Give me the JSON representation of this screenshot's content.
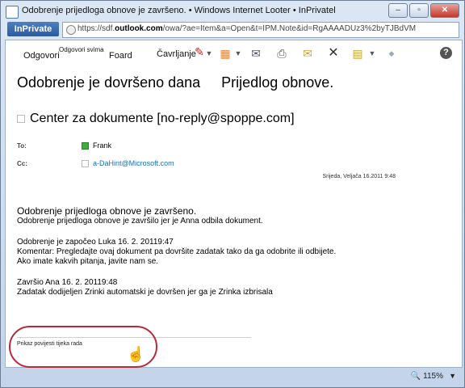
{
  "window": {
    "title": "Odobrenje prijedloga obnove je završeno. • Windows Internet Looter • InPrivatel",
    "buttons": {
      "minimize": "–",
      "maximize": "▫",
      "close": "✕"
    }
  },
  "address": {
    "inprivate_label": "InPrivate",
    "url_prefix": "https://sdf.",
    "url_domain": "outlook.com",
    "url_rest": "/owa/?ae=Item&a=Open&t=IPM.Note&id=RgAAAADUz3%2byTJBdVM"
  },
  "toolbar": {
    "reply_label": "Odgovori",
    "reply_all_label": "Odgovori svima",
    "forward_label": "Foard",
    "flag_label": "Čavrljanje",
    "help_label": "?"
  },
  "message": {
    "subject_part1": "Odobrenje je dovršeno dana",
    "subject_part2": "Prijedlog obnove.",
    "sender": "Center za dokumente [no-reply@spoppe.com]",
    "to_label": "To:",
    "to_value": "Frank",
    "cc_label": "Cc:",
    "cc_value": "a-DaHint@Microsoft.com",
    "date": "Srijeda, Veljača 16.2011 9:48"
  },
  "body": {
    "heading": "Odobrenje prijedloga obnove je završeno.",
    "line1": "Odobrenje prijedloga obnove je završilo jer je Anna odbila dokument.",
    "started": "Odobrenje je započeo Luka 16. 2. 20119:47",
    "comment": "Komentar: Pregledajte ovaj dokument pa dovršite zadatak tako da ga odobrite ili odbijete.",
    "questions": "Ako imate kakvih pitanja, javite nam se.",
    "finished": "Završio Ana 16. 2. 20119:48",
    "task": "Zadatak dodijeljen Zrinki automatski je dovršen jer ga je Zrinka izbrisala"
  },
  "workflow": {
    "link_label": "Prikaz povijesti tijeka rada"
  },
  "statusbar": {
    "zoom": "115%"
  },
  "colors": {
    "highlight_circle": "#b82a3a",
    "link": "#1a6fb5",
    "inprivate": "#2b5a9f"
  }
}
